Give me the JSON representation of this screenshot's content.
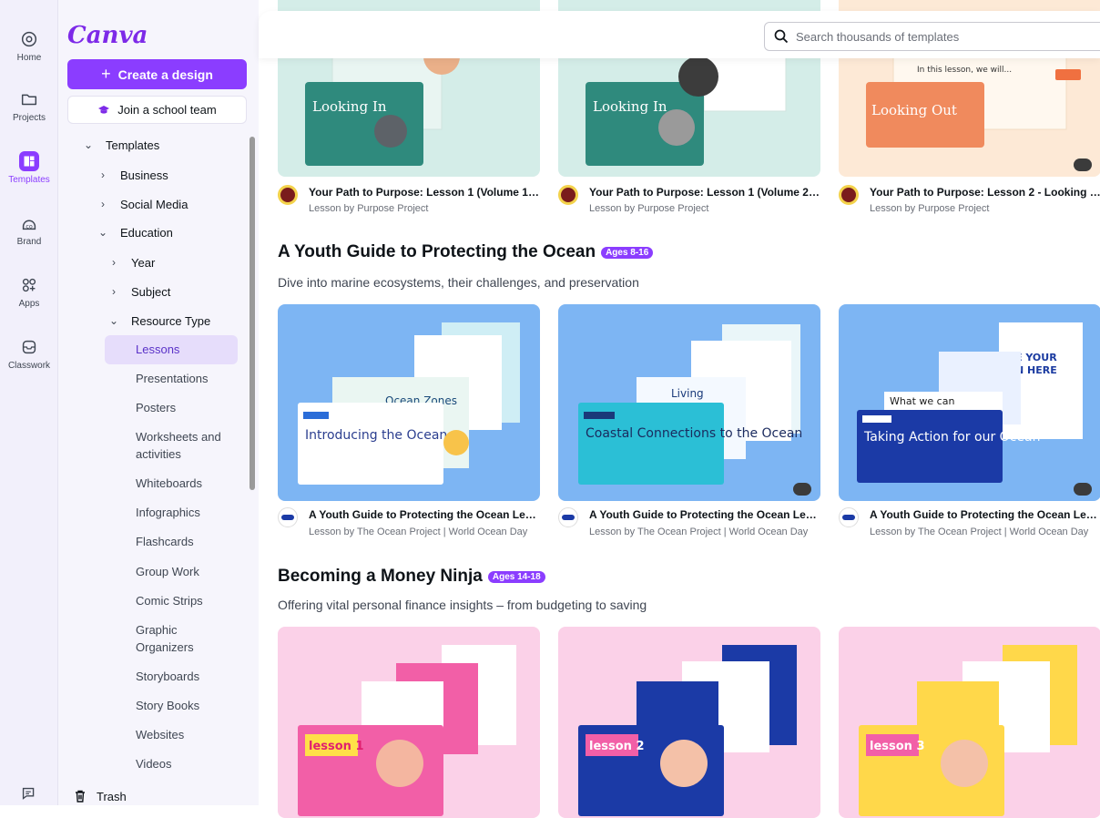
{
  "rail": {
    "items": [
      {
        "label": "Home",
        "icon": "home-icon"
      },
      {
        "label": "Projects",
        "icon": "folder-icon"
      },
      {
        "label": "Templates",
        "icon": "templates-icon"
      },
      {
        "label": "Brand",
        "icon": "brand-icon"
      },
      {
        "label": "Apps",
        "icon": "apps-icon"
      },
      {
        "label": "Classwork",
        "icon": "classwork-icon"
      }
    ]
  },
  "sidebar": {
    "logo": "Canva",
    "create_label": "Create a design",
    "join_label": "Join a school team",
    "tree": {
      "templates": "Templates",
      "business": "Business",
      "social_media": "Social Media",
      "education": "Education",
      "year": "Year",
      "subject": "Subject",
      "resource_type": "Resource Type"
    },
    "resource_types": [
      "Lessons",
      "Presentations",
      "Posters",
      "Worksheets and activities",
      "Whiteboards",
      "Infographics",
      "Flashcards",
      "Group Work",
      "Comic Strips",
      "Graphic Organizers",
      "Storyboards",
      "Story Books",
      "Websites",
      "Videos"
    ],
    "trash_label": "Trash"
  },
  "search": {
    "placeholder": "Search thousands of templates"
  },
  "row1": {
    "cards": [
      {
        "title": "Your Path to Purpose: Lesson 1 (Volume 1) ...",
        "sub": "Lesson by Purpose Project",
        "thumb_text": "Looking In"
      },
      {
        "title": "Your Path to Purpose: Lesson 1 (Volume 2) ...",
        "sub": "Lesson by Purpose Project",
        "thumb_text": "Looking In"
      },
      {
        "title": "Your Path to Purpose: Lesson 2 - Looking O...",
        "sub": "Lesson by Purpose Project",
        "thumb_text": "Looking Out"
      }
    ]
  },
  "ocean": {
    "title": "A Youth Guide to Protecting the Ocean",
    "badge": "Ages 8-16",
    "subtitle": "Dive into marine ecosystems, their challenges, and preservation",
    "cards": [
      {
        "title": "A Youth Guide to Protecting the Ocean Les...",
        "sub": "Lesson by The Ocean Project | World Ocean Day",
        "thumb_text": "Introducing the Ocean"
      },
      {
        "title": "A Youth Guide to Protecting the Ocean Les...",
        "sub": "Lesson by The Ocean Project | World Ocean Day",
        "thumb_text": "Coastal Connections to the Ocean"
      },
      {
        "title": "A Youth Guide to Protecting the Ocean Les...",
        "sub": "Lesson by The Ocean Project | World Ocean Day",
        "thumb_text": "Taking Action for our Ocean"
      }
    ]
  },
  "money": {
    "title": "Becoming a Money Ninja",
    "badge": "Ages 14-18",
    "subtitle": "Offering vital personal finance insights – from budgeting to saving",
    "cards": [
      {
        "thumb_text": "lesson 1"
      },
      {
        "thumb_text": "lesson 2"
      },
      {
        "thumb_text": "lesson 3"
      }
    ]
  },
  "colors": {
    "accent": "#8b3dff",
    "rail_bg": "#f2f0fb",
    "panel_bg": "#f6f5fc"
  }
}
